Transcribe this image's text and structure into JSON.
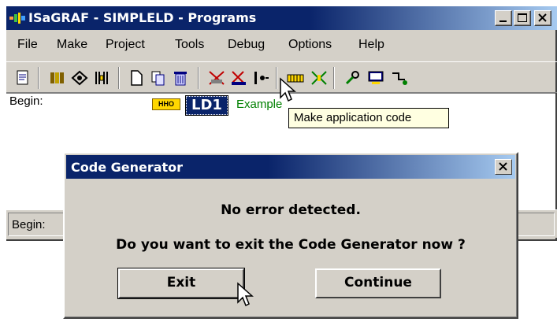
{
  "window": {
    "title": "ISaGRAF - SIMPLELD - Programs"
  },
  "menu": {
    "items": [
      "File",
      "Make",
      "Project",
      "Tools",
      "Debug",
      "Options",
      "Help"
    ]
  },
  "toolbar": {
    "icons": [
      "page-icon",
      "library-icon",
      "connect-icon",
      "io-icon",
      "new-icon",
      "copy-icon",
      "delete-icon",
      "make-application-icon",
      "touch-icon",
      "verify-icon",
      "variables-icon",
      "dictionary-icon",
      "debug-icon",
      "monitor-icon",
      "link-icon"
    ],
    "tooltip": "Make application code"
  },
  "editor": {
    "begin_label": "Begin:",
    "badge": "HHO",
    "program_name": "LD1",
    "comment": "Example"
  },
  "status": {
    "text": "Begin:"
  },
  "dialog": {
    "title": "Code Generator",
    "message1": "No error detected.",
    "message2": "Do you want to exit the Code Generator now ?",
    "exit_label": "Exit",
    "continue_label": "Continue"
  },
  "colors": {
    "titlebar": "#0a246a",
    "face": "#d4d0c8",
    "tooltip_bg": "#ffffe1",
    "comment": "#008000"
  }
}
